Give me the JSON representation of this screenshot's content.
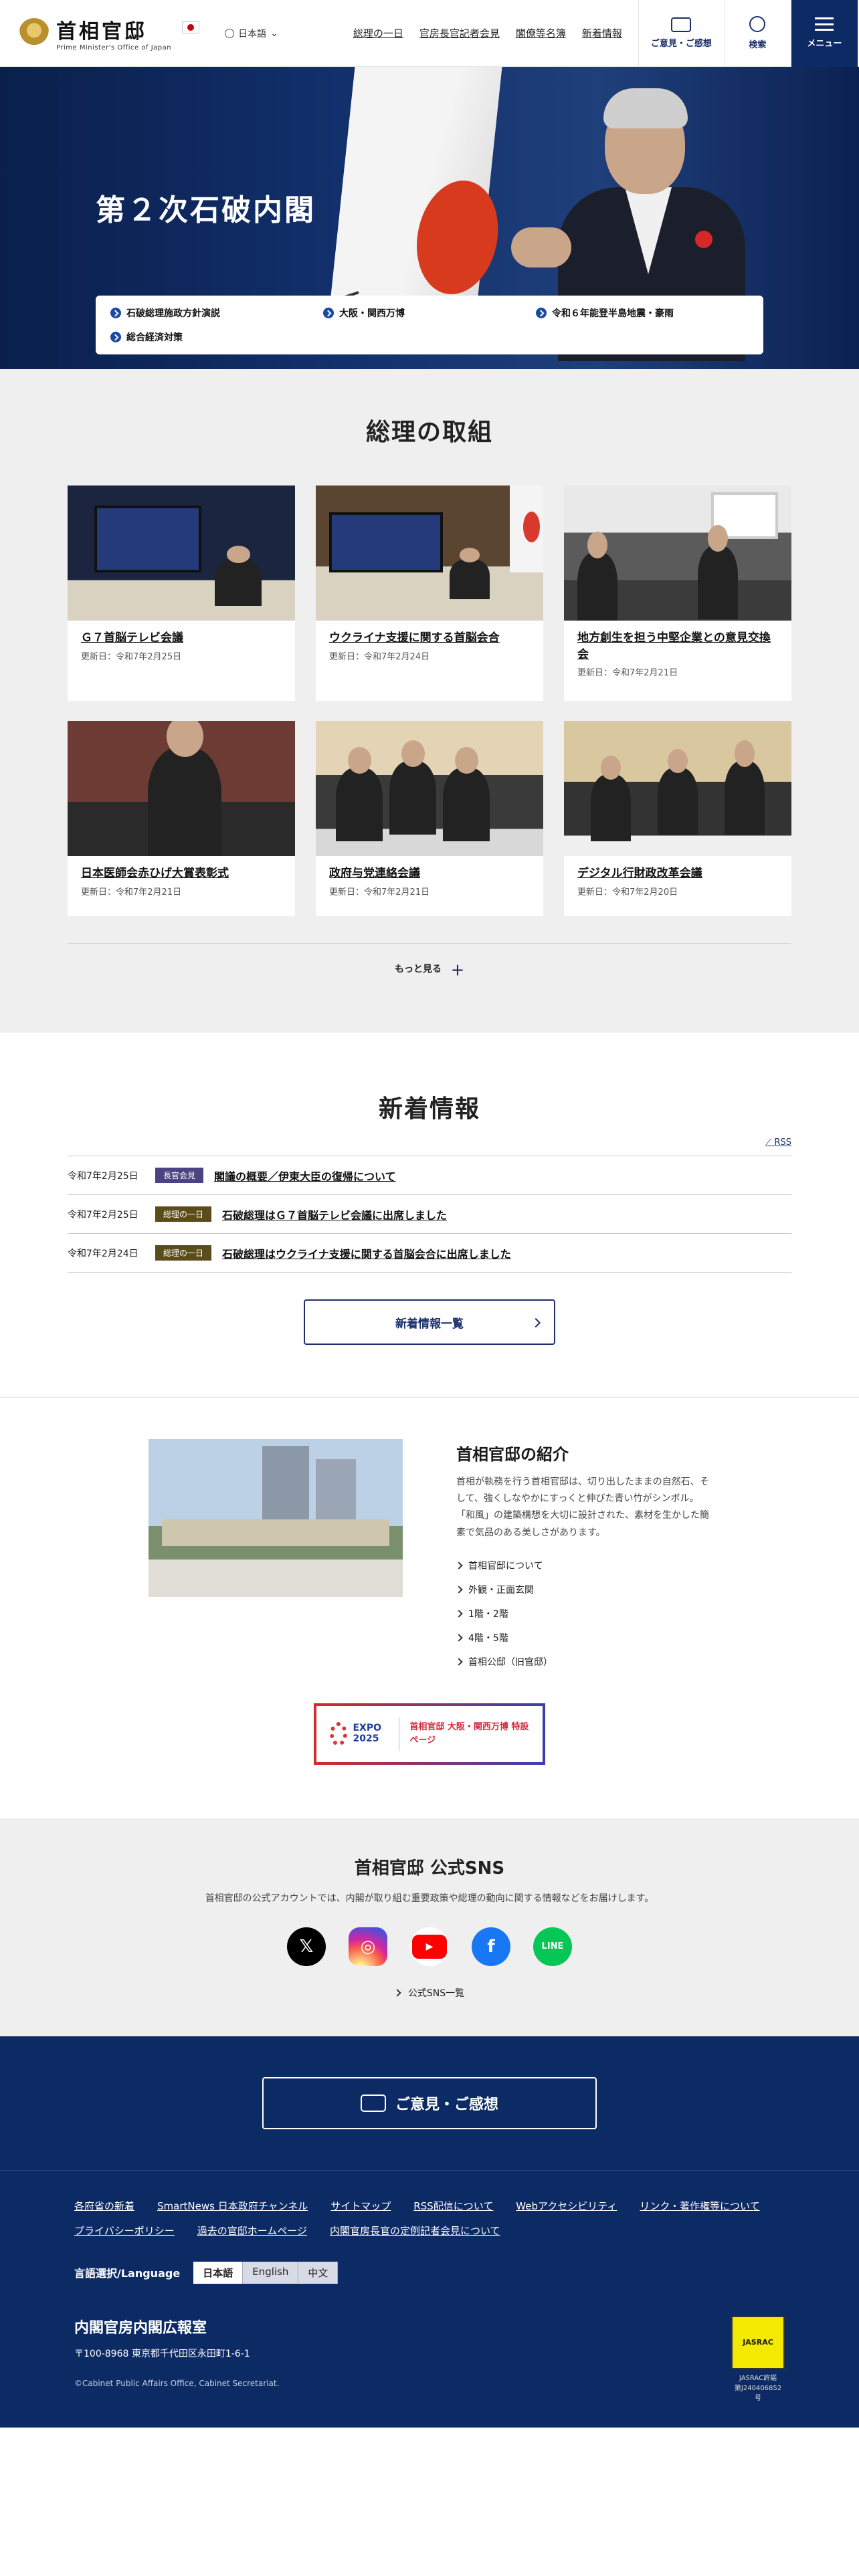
{
  "header": {
    "logo_main": "首相官邸",
    "logo_sub": "Prime Minister's Office of Japan",
    "lang": "日本語",
    "nav": [
      "総理の一日",
      "官房長官記者会見",
      "閣僚等名簿",
      "新着情報"
    ],
    "feedback_label": "ご意見・ご感想",
    "search_label": "検索",
    "menu_label": "メニュー"
  },
  "hero": {
    "title": "第２次石破内閣",
    "links": [
      "石破総理施政方針演説",
      "大阪・関西万博",
      "令和６年能登半島地震・豪雨",
      "総合経済対策"
    ]
  },
  "torikumi": {
    "title": "総理の取組",
    "cards": [
      {
        "title": "Ｇ７首脳テレビ会議",
        "date": "更新日：令和7年2月25日"
      },
      {
        "title": "ウクライナ支援に関する首脳会合",
        "date": "更新日：令和7年2月24日"
      },
      {
        "title": "地方創生を担う中堅企業との意見交換会",
        "date": "更新日：令和7年2月21日"
      },
      {
        "title": "日本医師会赤ひげ大賞表彰式",
        "date": "更新日：令和7年2月21日"
      },
      {
        "title": "政府与党連絡会議",
        "date": "更新日：令和7年2月21日"
      },
      {
        "title": "デジタル行財政改革会議",
        "date": "更新日：令和7年2月20日"
      }
    ],
    "more_label": "もっと見る"
  },
  "news": {
    "title": "新着情報",
    "rss_label": "RSS",
    "items": [
      {
        "date": "令和7年2月25日",
        "badge": "長官会見",
        "title": "閣議の概要／伊東大臣の復帰について"
      },
      {
        "date": "令和7年2月25日",
        "badge": "総理の一日",
        "title": "石破総理はＧ７首脳テレビ会議に出席しました"
      },
      {
        "date": "令和7年2月24日",
        "badge": "総理の一日",
        "title": "石破総理はウクライナ支援に関する首脳会合に出席しました"
      }
    ],
    "list_button": "新着情報一覧"
  },
  "intro": {
    "title": "首相官邸の紹介",
    "text": "首相が執務を行う首相官邸は、切り出したままの自然石、そして、強くしなやかにすっくと伸びた青い竹がシンボル。「和風」の建築構想を大切に設計された、素材を生かした簡素で気品のある美しさがあります。",
    "links": [
      "首相官邸について",
      "外観・正面玄関",
      "1階・2階",
      "4階・5階",
      "首相公邸（旧官邸）"
    ],
    "expo_word": "EXPO 2025",
    "expo_text": "首相官邸 大阪・関西万博 特設ページ"
  },
  "sns": {
    "title": "首相官邸 公式SNS",
    "desc": "首相官邸の公式アカウントでは、内閣が取り組む重要政策や総理の動向に関する情報などをお届けします。",
    "icons": [
      {
        "name": "x-icon",
        "glyph": "𝕏"
      },
      {
        "name": "instagram-icon",
        "glyph": "◎"
      },
      {
        "name": "youtube-icon",
        "glyph": "▶"
      },
      {
        "name": "facebook-icon",
        "glyph": "f"
      },
      {
        "name": "line-icon",
        "glyph": "LINE"
      }
    ],
    "all_label": "公式SNS一覧"
  },
  "feedback": {
    "label": "ご意見・ご感想"
  },
  "footer": {
    "links": [
      "各府省の新着",
      "SmartNews 日本政府チャンネル",
      "サイトマップ",
      "RSS配信について",
      "Webアクセシビリティ",
      "リンク・著作権等について",
      "プライバシーポリシー",
      "過去の官邸ホームページ",
      "内閣官房長官の定例記者会見について"
    ],
    "lang_label": "言語選択/Language",
    "langs": [
      "日本語",
      "English",
      "中文"
    ],
    "org": "内閣官房内閣広報室",
    "address": "〒100-8968 東京都千代田区永田町1-6-1",
    "copyright": "©Cabinet Public Affairs Office, Cabinet Secretariat.",
    "jasrac_mark": "JASRAC",
    "jasrac_text": "JASRAC許諾\n第J240406852号"
  }
}
